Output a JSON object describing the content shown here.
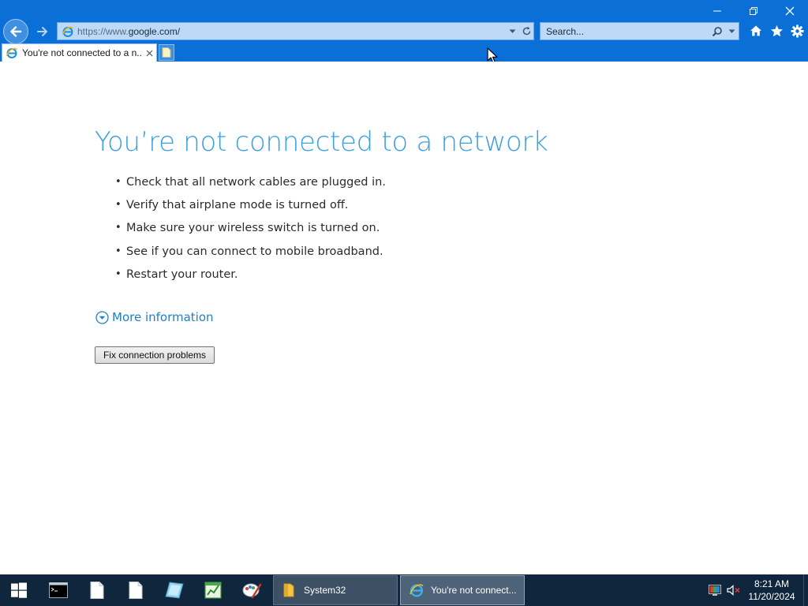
{
  "browser": {
    "window_controls": {
      "minimize": "–",
      "restore": "❐",
      "close": "✕"
    },
    "address": {
      "prefix": "https://www.",
      "host": "google.com/"
    },
    "search": {
      "placeholder": "Search..."
    },
    "tab": {
      "title": "You're not connected to a n..."
    },
    "toolbar": {
      "icons": [
        "home-icon",
        "favorites-star-icon",
        "tools-gear-icon"
      ]
    }
  },
  "page": {
    "heading": "You’re not connected to a network",
    "tips": [
      "Check that all network cables are plugged in.",
      "Verify that airplane mode is turned off.",
      "Make sure your wireless switch is turned on.",
      "See if you can connect to mobile broadband.",
      "Restart your router."
    ],
    "more_information": "More information",
    "fix_button": "Fix connection problems"
  },
  "taskbar": {
    "pinned": [
      "command-prompt-icon",
      "blank-document-icon",
      "blank-document-icon",
      "notepad-tablet-icon",
      "spreadsheet-icon",
      "paint-icon"
    ],
    "tasks": [
      {
        "label": "System32",
        "icon": "folder-icon"
      },
      {
        "label": "You're not connect...",
        "icon": "internet-explorer-icon"
      }
    ],
    "clock": {
      "time": "8:21 AM",
      "date": "11/20/2024"
    }
  },
  "colors": {
    "chrome_blue": "#0a6fd6",
    "heading_blue": "#3aa0df",
    "link_blue": "#1f7fc7",
    "taskbar": "#10263d"
  }
}
